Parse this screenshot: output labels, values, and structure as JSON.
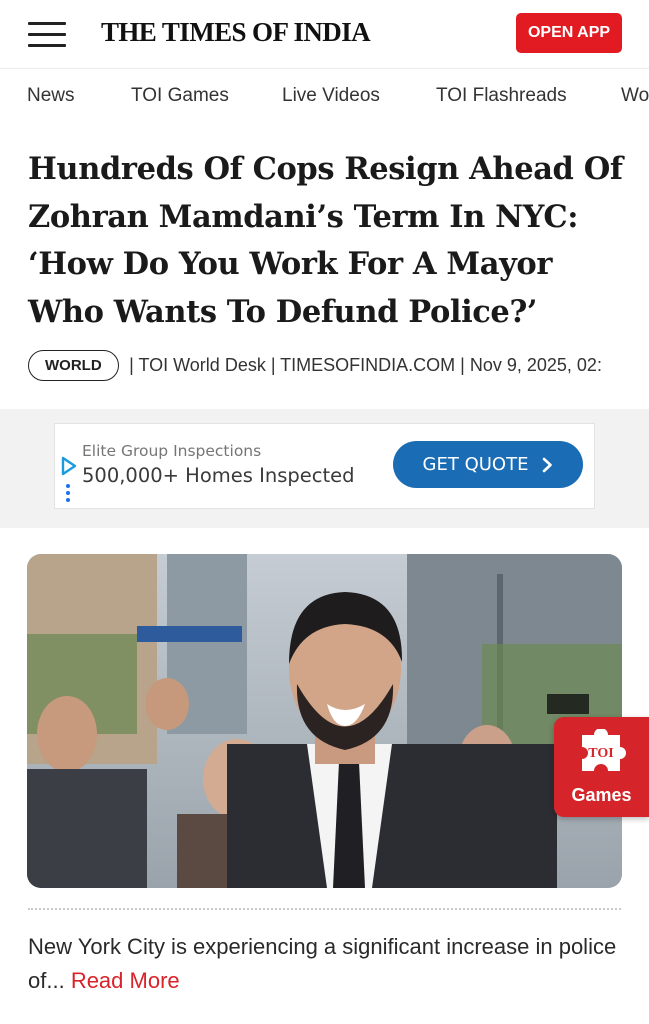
{
  "header": {
    "logo": "THE TIMES OF INDIA",
    "open_app_label": "OPEN APP"
  },
  "nav": {
    "items": [
      "News",
      "TOI Games",
      "Live Videos",
      "TOI Flashreads",
      "Wo"
    ]
  },
  "article": {
    "headline_lines": [
      "Hundreds Of Cops Resign Ahead Of",
      "Zohran Mamdani’s Term In NYC:",
      "‘How Do You Work For A Mayor",
      "Who Wants To Defund Police?’"
    ],
    "section_badge": "WORLD",
    "meta": "| TOI World Desk | TIMESOFINDIA.COM | Nov 9, 2025, 02:",
    "summary": "New York City is experiencing a significant increase in police of...",
    "read_more_label": "Read More"
  },
  "ad": {
    "advertiser": "Elite Group Inspections",
    "headline": "500,000+ Homes Inspected",
    "cta_label": "GET QUOTE",
    "cta_color": "#1a6db5",
    "icons": [
      "ad-choices-icon",
      "chevron-right-icon",
      "more-options-icon"
    ]
  },
  "games_widget": {
    "logo_text": "TOI",
    "label": "Games",
    "color": "#d6252a"
  },
  "colors": {
    "brand_red": "#e21b22",
    "read_more": "#d8232a"
  }
}
